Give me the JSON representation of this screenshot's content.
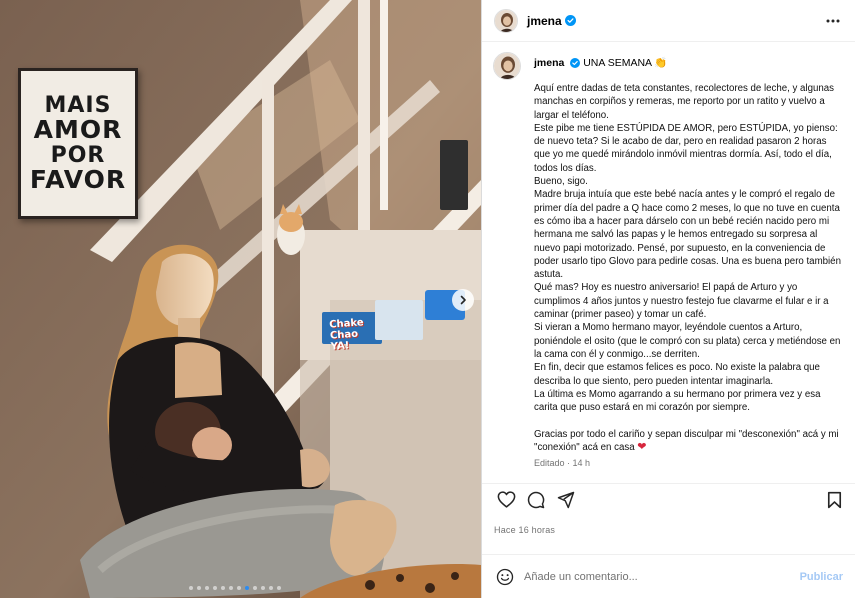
{
  "post": {
    "username": "jmena",
    "photo": {
      "poster_lines": [
        "MAIS",
        "AMOR",
        "POR",
        "FAVOR"
      ],
      "box_label": "Chake Chao YA!",
      "carousel_total": 12,
      "carousel_active": 8
    }
  },
  "caption": {
    "username": "jmena",
    "title": "UNA SEMANA",
    "title_emoji": "👏",
    "paragraphs": [
      "Aquí entre dadas de teta constantes, recolectores de leche, y algunas manchas en corpiños y remeras, me reporto por un ratito y vuelvo a largar el teléfono.",
      "Este pibe me tiene ESTÚPIDA DE AMOR, pero ESTÚPIDA, yo pienso: de nuevo teta? Si le acabo de dar, pero en realidad pasaron 2 horas que yo me quedé mirándolo inmóvil mientras dormía. Así, todo el día, todos los días.",
      "Bueno, sigo.",
      "Madre bruja intuía que este bebé nacía antes y le compró el regalo de primer día del padre a Q hace como 2 meses, lo que no tuve en cuenta es cómo iba a hacer para dárselo con un bebé recién nacido pero mi hermana me salvó las papas y le hemos entregado su sorpresa al nuevo papi motorizado. Pensé, por supuesto, en la conveniencia de poder usarlo tipo Glovo para pedirle cosas. Una es buena pero también astuta.",
      "Qué mas? Hoy es nuestro aniversario! El papá de Arturo y yo cumplimos 4 años juntos y nuestro festejo fue clavarme el fular e ir a caminar (primer paseo) y tomar un café.",
      "Si vieran a Momo hermano mayor, leyéndole cuentos a Arturo, poniéndole el osito (que le compró con su plata) cerca y metiéndose en la cama con él y conmigo...se derriten.",
      "En fin, decir que estamos felices es poco. No existe la palabra que describa lo que siento, pero pueden intentar imaginarla.",
      "La última es Momo agarrando a su hermano por primera vez y esa carita que puso estará en mi corazón por siempre."
    ],
    "closing": "Gracias por todo el cariño y sepan disculpar mi \"desconexión\" acá y mi \"conexión\" acá en casa",
    "closing_emoji": "❤",
    "edited": "Editado · 14 h"
  },
  "timestamp": "Hace 16 horas",
  "comment": {
    "placeholder": "Añade un comentario...",
    "post_label": "Publicar"
  },
  "colors": {
    "verified": "#0095f6",
    "post_disabled": "#a5c9f5",
    "heart": "#d7263d"
  },
  "icons": [
    "more-icon",
    "verified-icon",
    "heart-icon",
    "comment-icon",
    "share-icon",
    "bookmark-icon",
    "emoji-icon",
    "carousel-next-icon"
  ]
}
